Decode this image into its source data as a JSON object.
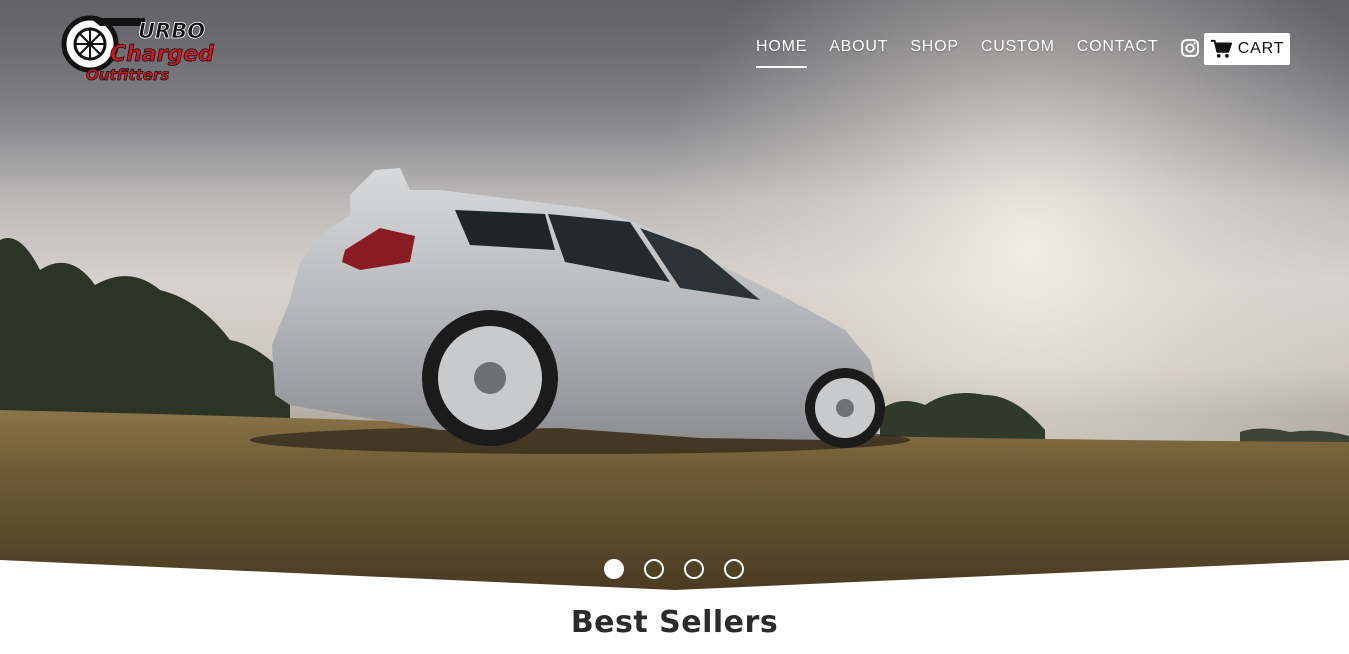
{
  "brand": {
    "logo_lines": [
      "URBO",
      "Charged",
      "Outfitters"
    ],
    "logo_initial": "T",
    "colors": {
      "red": "#d4121c",
      "black": "#111111"
    }
  },
  "nav": {
    "items": [
      {
        "label": "HOME",
        "active": true
      },
      {
        "label": "ABOUT",
        "active": false
      },
      {
        "label": "SHOP",
        "active": false
      },
      {
        "label": "CUSTOM",
        "active": false
      },
      {
        "label": "CONTACT",
        "active": false
      }
    ],
    "instagram_icon": "instagram-icon",
    "cart_label": "CART",
    "cart_icon": "cart-icon"
  },
  "slider": {
    "slide_count": 4,
    "active_index": 0
  },
  "section": {
    "title": "Best Sellers"
  }
}
